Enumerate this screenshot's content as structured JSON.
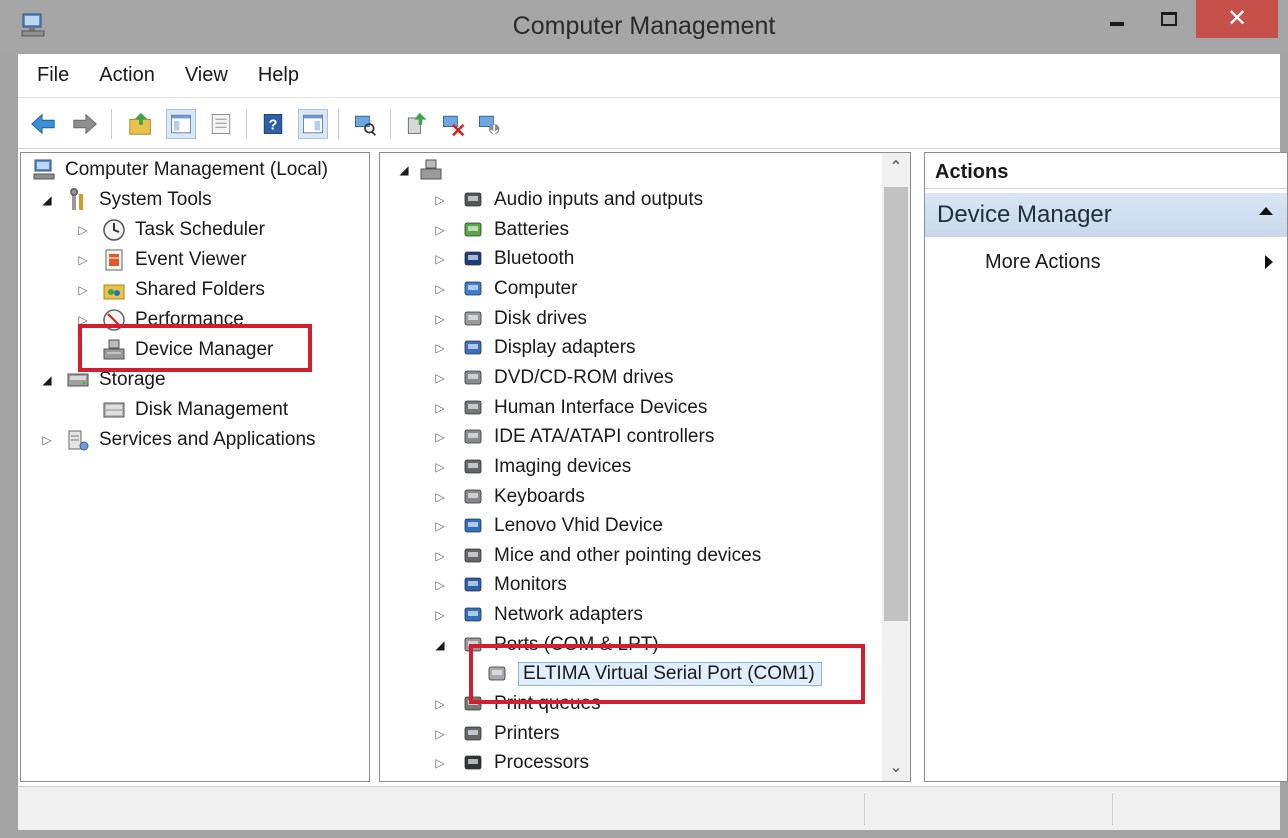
{
  "window": {
    "title": "Computer Management",
    "close_glyph": "✕"
  },
  "menu": [
    "File",
    "Action",
    "View",
    "Help"
  ],
  "toolbar_icons": [
    "back-arrow-icon",
    "forward-arrow-icon",
    "up-folder-icon",
    "show-hide-console-tree-icon",
    "properties-icon",
    "help-icon",
    "show-hide-action-pane-icon",
    "scan-hardware-icon",
    "update-driver-icon",
    "uninstall-device-icon",
    "enable-device-icon"
  ],
  "left_tree": {
    "root": "Computer Management (Local)",
    "items": [
      {
        "label": "System Tools",
        "expanded": true
      },
      {
        "label": "Task Scheduler"
      },
      {
        "label": "Event Viewer"
      },
      {
        "label": "Shared Folders"
      },
      {
        "label": "Performance"
      },
      {
        "label": "Device Manager",
        "selected": true
      },
      {
        "label": "Storage",
        "expanded": true
      },
      {
        "label": "Disk Management"
      },
      {
        "label": "Services and Applications"
      }
    ]
  },
  "device_tree": {
    "categories": [
      "Audio inputs and outputs",
      "Batteries",
      "Bluetooth",
      "Computer",
      "Disk drives",
      "Display adapters",
      "DVD/CD-ROM drives",
      "Human Interface Devices",
      "IDE ATA/ATAPI controllers",
      "Imaging devices",
      "Keyboards",
      "Lenovo Vhid Device",
      "Mice and other pointing devices",
      "Monitors",
      "Network adapters",
      "Ports (COM & LPT)",
      "ELTIMA Virtual Serial Port (COM1)",
      "Print queues",
      "Printers",
      "Processors"
    ]
  },
  "actions": {
    "header": "Actions",
    "group": "Device Manager",
    "item": "More Actions"
  },
  "colors": {
    "highlight": "#d21f2f",
    "close_button": "#c7504a",
    "selection": "#e1effc"
  }
}
